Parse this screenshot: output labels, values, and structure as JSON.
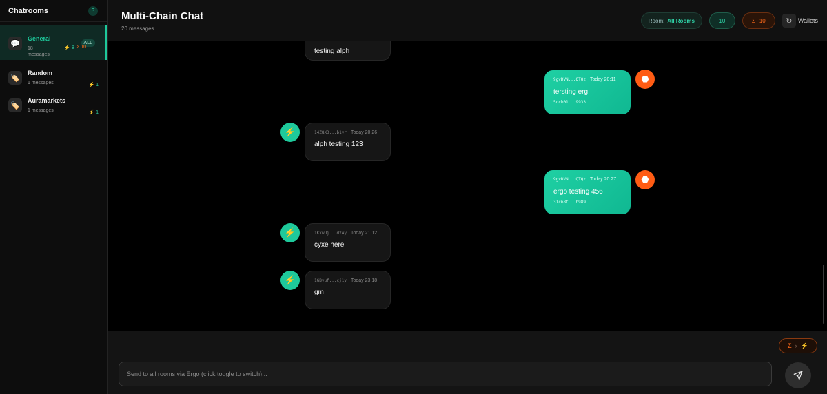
{
  "sidebar": {
    "title": "Chatrooms",
    "count": "3",
    "rooms": [
      {
        "name": "General",
        "sub1": "18",
        "sub2": "messages",
        "alph": "⚡ 8",
        "erg": "Σ 10",
        "tag": "ALL",
        "icon": "speech-bubble-icon"
      },
      {
        "name": "Random",
        "sub1": "1 messages",
        "alph": "⚡ 1",
        "icon": "tag-icon"
      },
      {
        "name": "Auramarkets",
        "sub1": "1 messages",
        "alph": "⚡ 1",
        "icon": "tag-icon"
      }
    ]
  },
  "header": {
    "title": "Multi-Chain Chat",
    "subtitle": "20 messages",
    "room_label": "Room:",
    "room_value": "All Rooms",
    "alph_count": "10",
    "erg_symbol": "Σ",
    "erg_count": "10",
    "wallets_label": "Wallets"
  },
  "messages": [
    {
      "side": "in",
      "chain": "alph",
      "address": "",
      "time": "",
      "text": "testing alph"
    },
    {
      "side": "out",
      "chain": "erg",
      "address": "9gvDVN...QTQz",
      "time": "Today 20:11",
      "text": "tersting erg",
      "hash": "5ccb01...9933"
    },
    {
      "side": "in",
      "chain": "alph",
      "address": "14Z8XD...b1vr",
      "time": "Today 20:26",
      "text": "alph testing 123"
    },
    {
      "side": "out",
      "chain": "erg",
      "address": "9gvDVN...QTQz",
      "time": "Today 20:27",
      "text": "ergo testing 456",
      "hash": "31c68f...b989"
    },
    {
      "side": "in",
      "chain": "alph",
      "address": "1KxwUj...dYAy",
      "time": "Today 21:12",
      "text": "cyxe here"
    },
    {
      "side": "in",
      "chain": "alph",
      "address": "1GBvuf...cj1y",
      "time": "Today 23:18",
      "text": "gm"
    }
  ],
  "composer": {
    "placeholder": "Send to all rooms via Ergo (click toggle to switch)...",
    "toggle_from": "Σ",
    "toggle_arrow": "›",
    "toggle_to": "⚡"
  },
  "colors": {
    "alph_accent": "#1ec99b",
    "erg_accent": "#ff5c14"
  }
}
